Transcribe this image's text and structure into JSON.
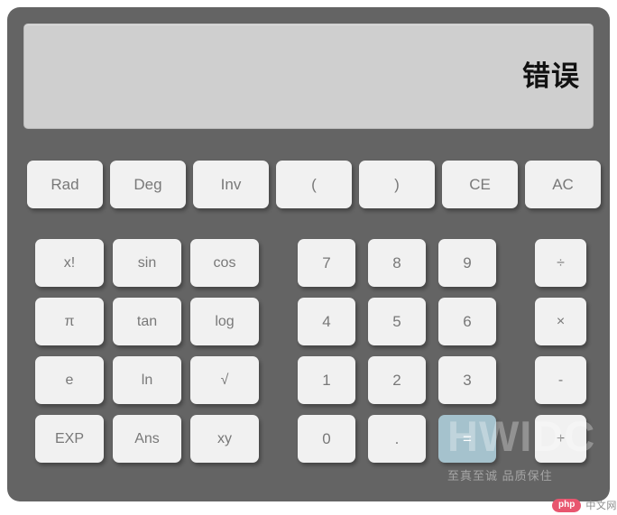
{
  "display": {
    "value": "错误"
  },
  "top_row": [
    {
      "label": "Rad",
      "name": "button-rad"
    },
    {
      "label": "Deg",
      "name": "button-deg"
    },
    {
      "label": "Inv",
      "name": "button-inv"
    },
    {
      "label": "(",
      "name": "button-open-paren"
    },
    {
      "label": ")",
      "name": "button-close-paren"
    },
    {
      "label": "CE",
      "name": "button-ce"
    },
    {
      "label": "AC",
      "name": "button-ac"
    }
  ],
  "function_keys": [
    {
      "label": "x!",
      "name": "button-factorial"
    },
    {
      "label": "sin",
      "name": "button-sin"
    },
    {
      "label": "cos",
      "name": "button-cos"
    },
    {
      "label": "π",
      "name": "button-pi"
    },
    {
      "label": "tan",
      "name": "button-tan"
    },
    {
      "label": "log",
      "name": "button-log"
    },
    {
      "label": "e",
      "name": "button-e"
    },
    {
      "label": "ln",
      "name": "button-ln"
    },
    {
      "label": "√",
      "name": "button-sqrt"
    },
    {
      "label": "EXP",
      "name": "button-exp"
    },
    {
      "label": "Ans",
      "name": "button-ans"
    },
    {
      "label": "xy",
      "name": "button-power"
    }
  ],
  "number_keys": [
    {
      "label": "7",
      "name": "button-7"
    },
    {
      "label": "8",
      "name": "button-8"
    },
    {
      "label": "9",
      "name": "button-9"
    },
    {
      "label": "4",
      "name": "button-4"
    },
    {
      "label": "5",
      "name": "button-5"
    },
    {
      "label": "6",
      "name": "button-6"
    },
    {
      "label": "1",
      "name": "button-1"
    },
    {
      "label": "2",
      "name": "button-2"
    },
    {
      "label": "3",
      "name": "button-3"
    },
    {
      "label": "0",
      "name": "button-0"
    },
    {
      "label": ".",
      "name": "button-decimal"
    },
    {
      "label": "=",
      "name": "button-equals"
    }
  ],
  "operator_keys": [
    {
      "label": "÷",
      "name": "button-divide"
    },
    {
      "label": "×",
      "name": "button-multiply"
    },
    {
      "label": "-",
      "name": "button-subtract"
    },
    {
      "label": "+",
      "name": "button-add"
    }
  ],
  "watermark": {
    "main": "HWIDC",
    "sub": "至真至诚 品质保住"
  },
  "footer_badge": {
    "pill": "php",
    "label": "中文网"
  },
  "colors": {
    "body": "#646464",
    "display": "#cfcfcf",
    "button": "#f1f1f1",
    "button_text": "#787878",
    "equals": "#a5c2cd",
    "badge": "#e8566f"
  }
}
